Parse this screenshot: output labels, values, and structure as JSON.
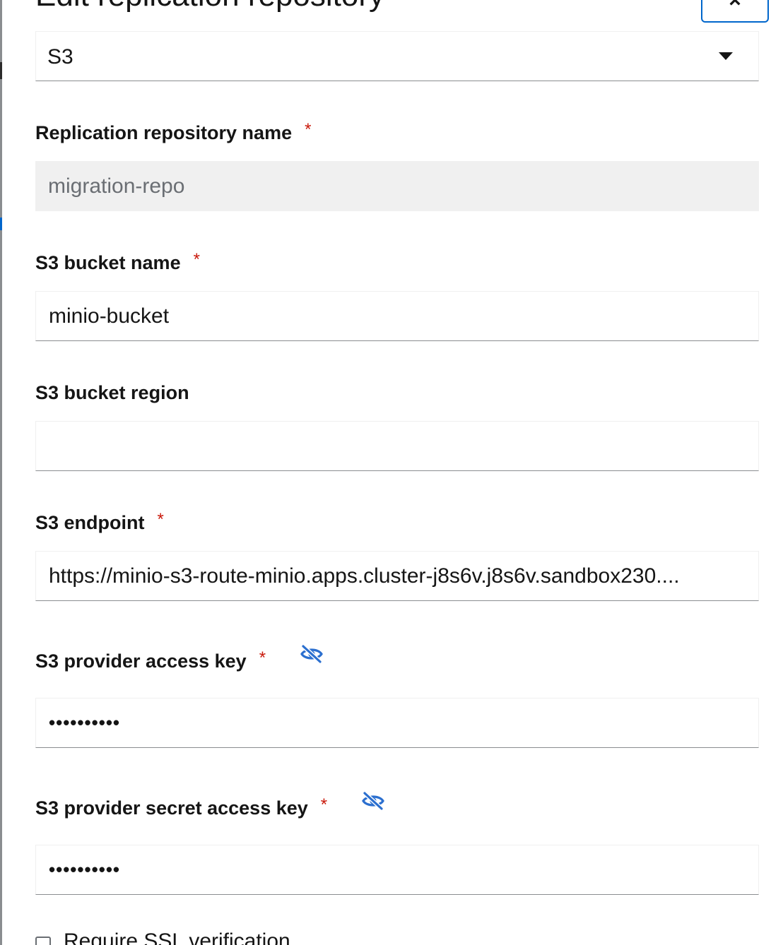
{
  "modal": {
    "title": "Edit replication repository",
    "close_label": "×"
  },
  "provider_select": {
    "value": "S3"
  },
  "required_marker": "*",
  "fields": {
    "repo_name": {
      "label": "Replication repository name",
      "value": "migration-repo",
      "required": true,
      "readonly": true
    },
    "bucket_name": {
      "label": "S3 bucket name",
      "value": "minio-bucket",
      "required": true
    },
    "bucket_region": {
      "label": "S3 bucket region",
      "value": "",
      "required": false
    },
    "endpoint": {
      "label": "S3 endpoint",
      "value": "https://minio-s3-route-minio.apps.cluster-j8s6v.j8s6v.sandbox230....",
      "required": true
    },
    "access_key": {
      "label": "S3 provider access key",
      "value": "••••••••••",
      "required": true,
      "icon": "eye-slash-icon"
    },
    "secret_key": {
      "label": "S3 provider secret access key",
      "value": "••••••••••",
      "required": true,
      "icon": "eye-slash-icon"
    }
  },
  "ssl_checkbox": {
    "label": "Require SSL verification",
    "checked": false
  },
  "colors": {
    "accent": "#0066cc",
    "required": "#c9190b",
    "readonly_bg": "#f0f0f0",
    "icon_blue": "#2b6fcf"
  }
}
